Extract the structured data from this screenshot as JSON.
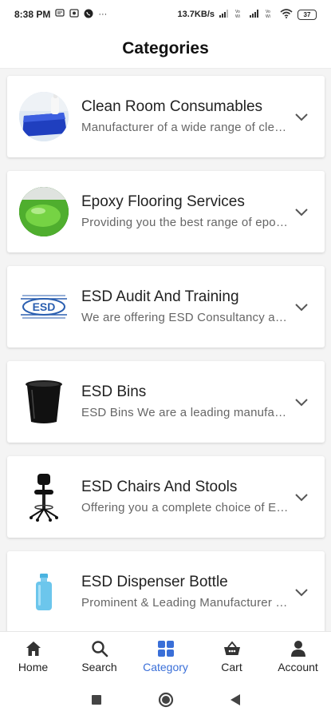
{
  "status_bar": {
    "time": "8:38 PM",
    "notification_icons": [
      "message-icon",
      "mail-icon",
      "whatsapp-icon"
    ],
    "more": "···",
    "speed": "13.7KB/s",
    "signal_icons": [
      "signal-icon",
      "volte-icon",
      "signal-icon",
      "volte-icon",
      "wifi-icon"
    ],
    "volte_label": "Vo\nWiFi",
    "battery": "37"
  },
  "header": {
    "title": "Categories"
  },
  "categories": [
    {
      "title": "Clean Room Consumables",
      "subtitle": "Manufacturer of a wide range of clean room consumables",
      "icon": "clean-room-mat-icon"
    },
    {
      "title": "Epoxy Flooring Services",
      "subtitle": "Providing you the best range of epoxy flooring services",
      "icon": "epoxy-floor-icon"
    },
    {
      "title": "ESD Audit And Training",
      "subtitle": "We are offering ESD Consultancy and training services",
      "icon": "esd-logo-icon",
      "logo_text": "ESD"
    },
    {
      "title": "ESD Bins",
      "subtitle": "ESD Bins We are a leading manufacturer of bins",
      "icon": "esd-bin-icon"
    },
    {
      "title": "ESD Chairs And Stools",
      "subtitle": "Offering you a complete choice of ESD chairs",
      "icon": "esd-chair-icon"
    },
    {
      "title": "ESD Dispenser Bottle",
      "subtitle": "Prominent & Leading Manufacturer of dispenser bottles",
      "icon": "dispenser-bottle-icon"
    }
  ],
  "bottom_nav": {
    "active": "Category",
    "items": [
      {
        "label": "Home",
        "icon": "home-icon"
      },
      {
        "label": "Search",
        "icon": "search-icon"
      },
      {
        "label": "Category",
        "icon": "grid-icon"
      },
      {
        "label": "Cart",
        "icon": "basket-icon"
      },
      {
        "label": "Account",
        "icon": "person-icon"
      }
    ]
  },
  "system_nav": [
    "recents-square-icon",
    "home-circle-icon",
    "back-triangle-icon"
  ],
  "colors": {
    "accent": "#3a6fd8",
    "list_background": "#f4f4f4",
    "card": "#ffffff"
  }
}
